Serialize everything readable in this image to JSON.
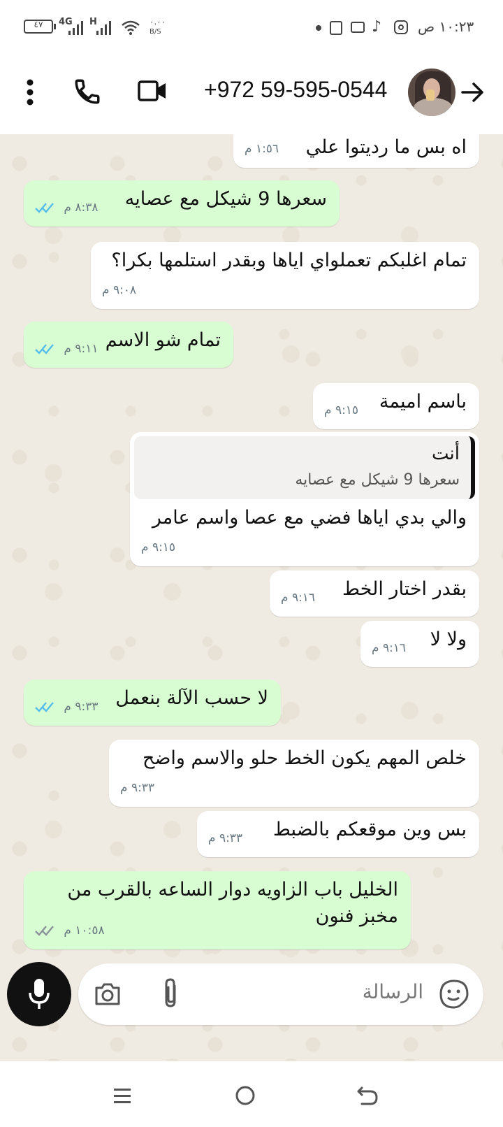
{
  "status_bar": {
    "time": "١٠:٢٣ ص",
    "battery": "٤٧",
    "net1": "4G",
    "net2": "H",
    "speed": "٠.٠٠",
    "speed_unit": "B/S"
  },
  "header": {
    "contact": "+972 59-595-0544",
    "back_icon": "arrow-right-icon",
    "avatar": "contact-avatar",
    "video_icon": "video-call-icon",
    "call_icon": "phone-icon",
    "menu_icon": "more-vert-icon"
  },
  "messages": [
    {
      "text": "اه بس ما رديتوا علي",
      "time": "١:٥٦ م"
    },
    {
      "text": "سعرها 9 شيكل مع عصايه",
      "time": "٨:٣٨ م"
    },
    {
      "text": "تمام اغلبكم تعملواي اياها وبقدر استلمها بكرا؟",
      "time": "٩:٠٨ م"
    },
    {
      "text": "تمام شو الاسم",
      "time": "٩:١١ م"
    },
    {
      "text": "باسم اميمة",
      "time": "٩:١٥ م"
    },
    {
      "quote_author": "أنت",
      "quote_text": "سعرها 9 شيكل مع عصايه",
      "text": "والي بدي اياها فضي مع عصا واسم عامر",
      "time": "٩:١٥ م"
    },
    {
      "text": "بقدر اختار الخط",
      "time": "٩:١٦ م"
    },
    {
      "text": "ولا لا",
      "time": "٩:١٦ م"
    },
    {
      "text": "لا حسب الآلة بنعمل",
      "time": "٩:٣٣ م"
    },
    {
      "text": "خلص المهم يكون الخط حلو والاسم واضح",
      "time": "٩:٣٣ م"
    },
    {
      "text": "بس وين موقعكم بالضبط",
      "time": "٩:٣٣ م"
    },
    {
      "line1": "الخليل باب الزاويه دوار الساعه بالقرب من",
      "line2": "مخبز فنون",
      "time": "١٠:٥٨ م"
    }
  ],
  "composer": {
    "placeholder": "الرسالة",
    "mic_icon": "microphone-icon",
    "camera_icon": "camera-icon",
    "attach_icon": "paperclip-icon",
    "sticker_icon": "sticker-icon"
  },
  "colors": {
    "incoming": "#ffffff",
    "outgoing": "#d9fdd3",
    "read_ticks": "#53bdeb",
    "chat_bg": "#efeae2"
  }
}
